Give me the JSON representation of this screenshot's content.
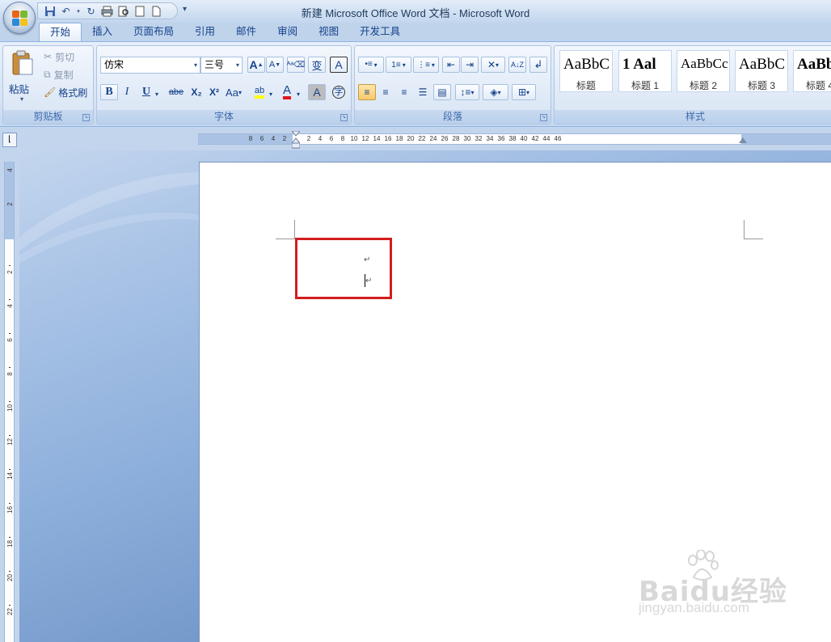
{
  "window": {
    "title": "新建 Microsoft Office Word 文档 - Microsoft Word"
  },
  "tabs": [
    "开始",
    "插入",
    "页面布局",
    "引用",
    "邮件",
    "审阅",
    "视图",
    "开发工具"
  ],
  "active_tab": "开始",
  "clipboard": {
    "paste": "粘贴",
    "cut": "剪切",
    "copy": "复制",
    "format_painter": "格式刷",
    "group_label": "剪贴板"
  },
  "font": {
    "name": "仿宋",
    "size": "三号",
    "group_label": "字体",
    "bold": "B",
    "italic": "I",
    "underline": "U",
    "strike": "abe",
    "subscript": "X₂",
    "superscript": "X²",
    "change_case": "Aa",
    "grow": "A",
    "shrink": "A",
    "phonetic": "变",
    "border_char": "A",
    "font_color": "A",
    "shade_char": "A",
    "enclose": "字"
  },
  "paragraph": {
    "group_label": "段落"
  },
  "styles": {
    "group_label": "样式",
    "items": [
      {
        "sample": "AaBbC",
        "name": "标题"
      },
      {
        "sample": "1   Aal",
        "name": "标题 1"
      },
      {
        "sample": "AaBbCc",
        "name": "标题 2"
      },
      {
        "sample": "AaBbC",
        "name": "标题 3"
      },
      {
        "sample": "AaBb",
        "name": "标题 4"
      }
    ]
  },
  "ruler": {
    "horizontal_left": [
      "8",
      "6",
      "4",
      "2"
    ],
    "horizontal_right": [
      "2",
      "4",
      "6",
      "8",
      "10",
      "12",
      "14",
      "16",
      "18",
      "20",
      "22",
      "24",
      "26",
      "28",
      "30",
      "32",
      "34",
      "36",
      "38",
      "40",
      "42",
      "44",
      "46"
    ],
    "vertical_top": [
      "4",
      "2"
    ],
    "vertical_body": [
      "2",
      "4",
      "6",
      "8",
      "10",
      "12",
      "14",
      "16",
      "18",
      "20",
      "22"
    ]
  },
  "document": {
    "paragraph_mark": "↵"
  },
  "watermark": {
    "brand": "Baidu经验",
    "url": "jingyan.baidu.com"
  },
  "colors": {
    "highlight_box": "#d21d1d",
    "accent": "#15428b"
  }
}
